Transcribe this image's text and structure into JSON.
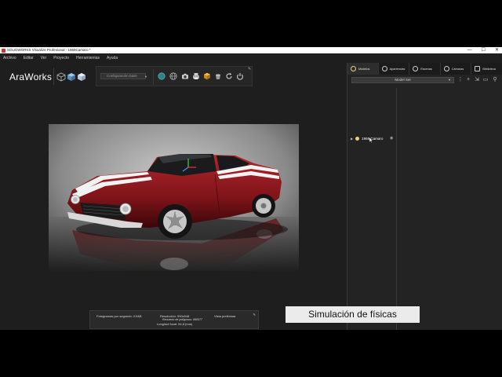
{
  "window": {
    "title": "SOLIDWORKS Visualize Profesional - 1969Camaro *",
    "controls": [
      "—",
      "☐",
      "✕"
    ]
  },
  "menu": [
    "Archivo",
    "Editar",
    "Ver",
    "Proyecto",
    "Herramientas",
    "Ayuda"
  ],
  "toolbar": {
    "logo_text": "AraWorks",
    "camera_select": "Configuración base",
    "icons": [
      "sphere-icon",
      "globe-icon",
      "camera-icon",
      "print-icon",
      "cube-icon",
      "bucket-icon",
      "refresh-icon",
      "power-icon",
      "pin-icon"
    ]
  },
  "right_panel": {
    "tabs": [
      {
        "label": "Modelos",
        "icon": "model-icon"
      },
      {
        "label": "Apariencias",
        "icon": "appearance-icon"
      },
      {
        "label": "Escenas",
        "icon": "scene-icon"
      },
      {
        "label": "Cámaras",
        "icon": "camera-icon"
      },
      {
        "label": "Biblioteca",
        "icon": "library-icon"
      }
    ],
    "active_tab": "Modelos",
    "model_set": "Model Set",
    "tree": [
      {
        "label": "1969 Camaro",
        "expanded": false,
        "visible": true
      }
    ]
  },
  "status": {
    "fps": "Fotogramas por segundo: XX&B",
    "resolution": "Resolución: 990x548",
    "polygons": "Recuento de polígonos: 990077",
    "focal": "Longitud focal: 54,8 (mm)",
    "preview": "Vista preliminar"
  },
  "caption": "Simulación de físicas",
  "colors": {
    "app_bg": "#1e1e1e",
    "panel_bg": "#232323",
    "car_red": "#8b1a1f",
    "caption_bg": "#ebebeb"
  }
}
